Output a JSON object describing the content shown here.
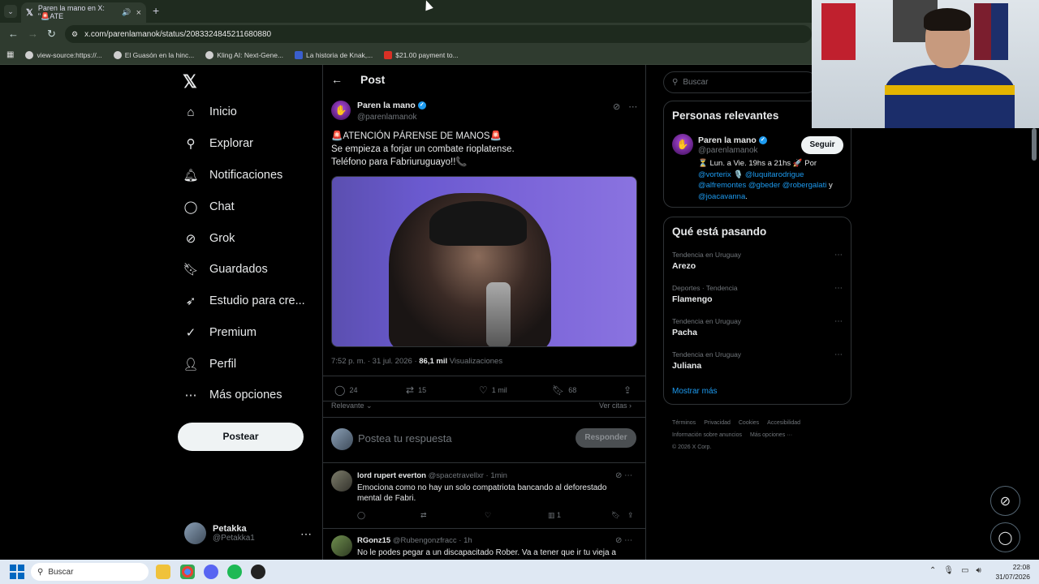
{
  "browser": {
    "tab_title": "Paren la mano en X: \"🚨ATE",
    "url": "x.com/parenlamanok/status/2083324845211680880",
    "bookmarks": [
      "view-source:https://...",
      "El Guasón en la hinc...",
      "Kling AI: Next-Gene...",
      "La historia de Knak,...",
      "$21.00 payment to..."
    ]
  },
  "nav": {
    "items": [
      {
        "label": "Inicio",
        "icon": "home-icon"
      },
      {
        "label": "Explorar",
        "icon": "search-icon"
      },
      {
        "label": "Notificaciones",
        "icon": "bell-icon"
      },
      {
        "label": "Chat",
        "icon": "chat-icon"
      },
      {
        "label": "Grok",
        "icon": "grok-icon"
      },
      {
        "label": "Guardados",
        "icon": "bookmark-icon"
      },
      {
        "label": "Estudio para cre...",
        "icon": "rocket-icon"
      },
      {
        "label": "Premium",
        "icon": "premium-icon"
      },
      {
        "label": "Perfil",
        "icon": "person-icon"
      },
      {
        "label": "Más opciones",
        "icon": "more-icon"
      }
    ],
    "post_button": "Postear",
    "user": {
      "name": "Petakka",
      "handle": "@Petakka1"
    }
  },
  "post": {
    "header": "Post",
    "author": "Paren la mano",
    "handle": "@parenlamanok",
    "line1": "🚨ATENCIÓN PÁRENSE DE MANOS🚨",
    "line2": "Se empieza a forjar un combate rioplatense.",
    "line3": "Teléfono para Fabriuruguayo!!📞",
    "time": "7:52 p. m. · 31 jul. 2026 · ",
    "views": "86,1 mil",
    "views_label": " Visualizaciones",
    "stats": {
      "replies": "24",
      "reposts": "15",
      "likes": "1 mil",
      "bookmarks": "68"
    },
    "sort": "Relevante",
    "quotes": "Ver citas",
    "reply_placeholder": "Postea tu respuesta",
    "reply_button": "Responder"
  },
  "comments": [
    {
      "name": "lord rupert everton",
      "handle": "@spacetravellxr · 1min",
      "text": "Emociona como no hay un solo compatriota bancando al deforestado mental de Fabri.",
      "views": "1"
    },
    {
      "name": "RGonz15",
      "handle": "@Rubengonzfracc · 1h",
      "text": "No le podes pegar a un discapacitado  Rober. Va a tener que ir tu vieja a"
    }
  ],
  "sidebar": {
    "search_placeholder": "Buscar",
    "relevant_title": "Personas relevantes",
    "relevant": {
      "name": "Paren la mano",
      "handle": "@parenlamanok",
      "follow": "Seguir",
      "bio_prefix": "⏳ Lun. a Vie. 19hs a 21hs 🚀 Por",
      "mentions_1": "@vorterix",
      "mic": "🎙️",
      "mentions_2": "@luquitarodrigue",
      "mentions_3": "@alfremontes @gbeder @robergalati",
      "and": " y",
      "mentions_4": "@joacavanna",
      "end": "."
    },
    "trending_title": "Qué está pasando",
    "trends": [
      {
        "category": "Tendencia en Uruguay",
        "topic": "Arezo"
      },
      {
        "category": "Deportes · Tendencia",
        "topic": "Flamengo"
      },
      {
        "category": "Tendencia en Uruguay",
        "topic": "Pacha"
      },
      {
        "category": "Tendencia en Uruguay",
        "topic": "Juliana"
      }
    ],
    "show_more": "Mostrar más",
    "footer": [
      "Términos",
      "Privacidad",
      "Cookies",
      "Accesibilidad",
      "Información sobre anuncios",
      "Más opciones ···",
      "© 2026 X Corp."
    ]
  },
  "taskbar": {
    "search": "Buscar",
    "time": "22:08",
    "date": "31/07/2026"
  },
  "colors": {
    "accent": "#1d9bf0",
    "background": "#000000",
    "muted": "#71767b"
  }
}
